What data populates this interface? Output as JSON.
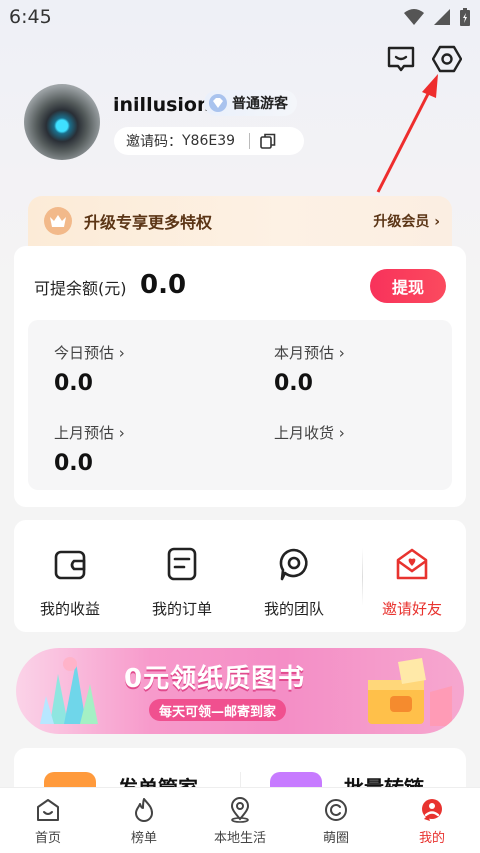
{
  "status_bar": {
    "time": "6:45"
  },
  "header": {
    "icons": [
      "message-icon",
      "settings-icon"
    ]
  },
  "profile": {
    "username": "inillusion",
    "level": "普通游客",
    "invite_label": "邀请码：",
    "invite_code": "Y86E39"
  },
  "vip": {
    "title": "升级专享更多特权",
    "link": "升级会员 ›"
  },
  "balance": {
    "label": "可提余额(元)",
    "value": "0.0",
    "withdraw": "提现",
    "stats": [
      {
        "label": "今日预估 ›",
        "value": "0.0"
      },
      {
        "label": "本月预估 ›",
        "value": "0.0"
      },
      {
        "label": "上月预估 ›",
        "value": "0.0"
      },
      {
        "label": "上月收货 ›",
        "value": ""
      }
    ]
  },
  "menu": [
    {
      "label": "我的收益",
      "icon": "wallet-icon"
    },
    {
      "label": "我的订单",
      "icon": "order-icon"
    },
    {
      "label": "我的团队",
      "icon": "team-icon"
    },
    {
      "label": "邀请好友",
      "icon": "invite-icon",
      "color": "#e8332f"
    }
  ],
  "banner": {
    "title": "0元领纸质图书",
    "subtitle": "每天可领—邮寄到家"
  },
  "tools": [
    {
      "label": "发单管家"
    },
    {
      "label": "批量转链"
    }
  ],
  "tabbar": [
    {
      "label": "首页",
      "icon": "home-icon"
    },
    {
      "label": "榜单",
      "icon": "flame-icon"
    },
    {
      "label": "本地生活",
      "icon": "location-icon"
    },
    {
      "label": "萌圈",
      "icon": "circle-chat-icon"
    },
    {
      "label": "我的",
      "icon": "profile-icon",
      "active": true
    }
  ],
  "colors": {
    "accent": "#e8332f",
    "withdraw": "#f8325b",
    "vip_text": "#5b3516"
  }
}
